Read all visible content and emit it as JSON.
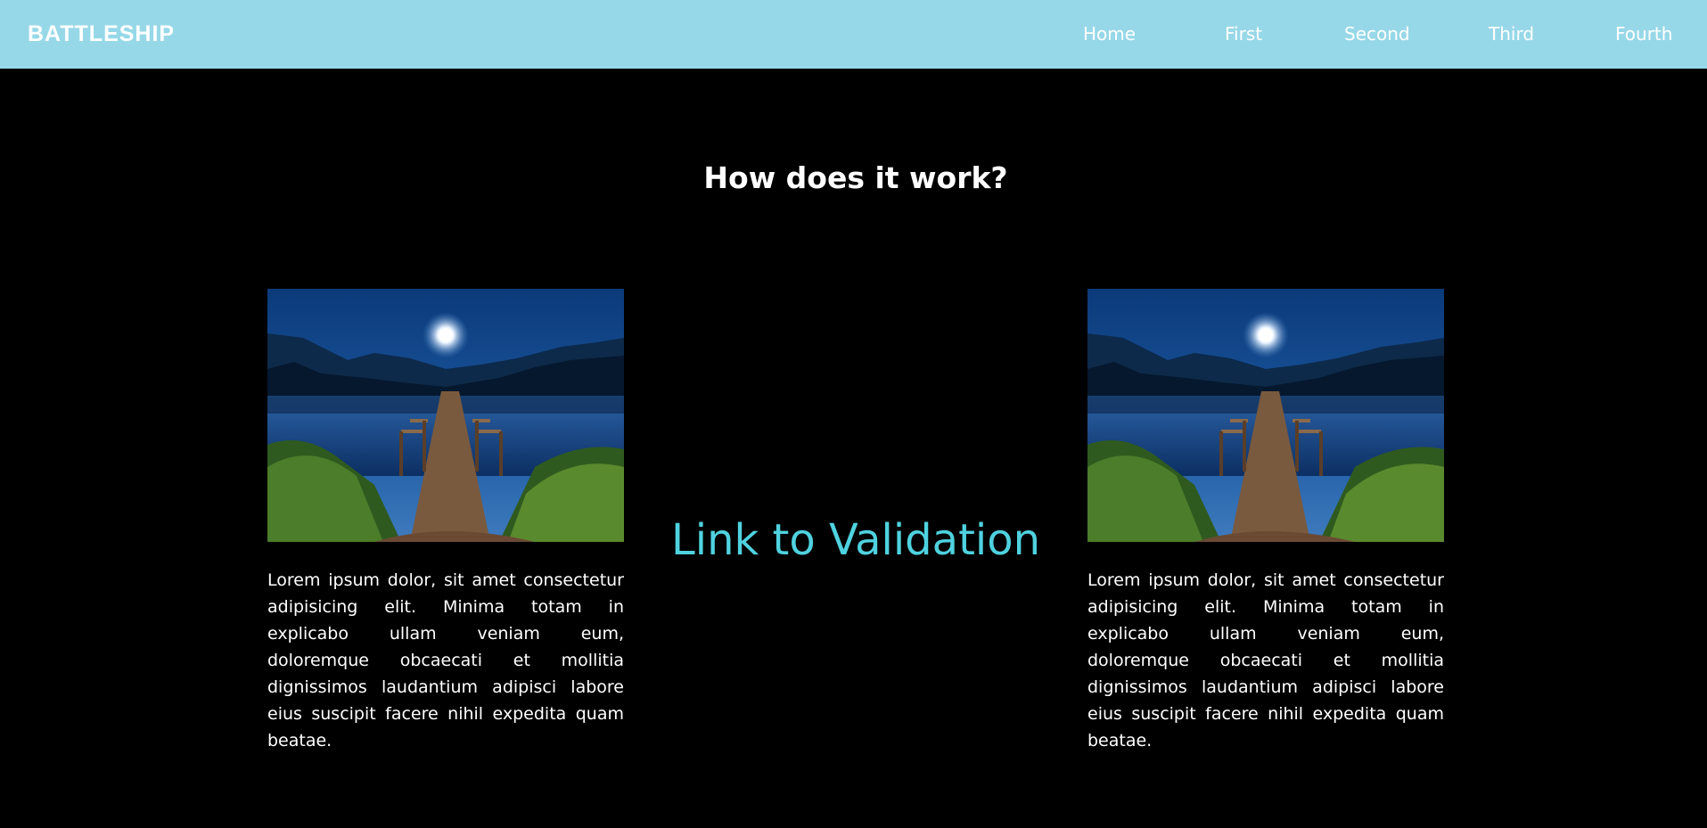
{
  "navbar": {
    "brand": "BATTLESHIP",
    "links": [
      "Home",
      "First",
      "Second",
      "Third",
      "Fourth"
    ]
  },
  "main": {
    "heading": "How does it work?",
    "center_link": "Link to Validation",
    "cards": [
      {
        "image": "night-lake-pier-photo",
        "text": "Lorem ipsum dolor, sit amet consectetur adipisicing elit. Minima totam in explicabo ullam veniam eum, doloremque obcaecati et mollitia dignissimos laudantium adipisci labore eius suscipit facere nihil expedita quam beatae."
      },
      {
        "image": "night-lake-pier-photo",
        "text": "Lorem ipsum dolor, sit amet consectetur adipisicing elit. Minima totam in explicabo ullam veniam eum, doloremque obcaecati et mollitia dignissimos laudantium adipisci labore eius suscipit facere nihil expedita quam beatae."
      }
    ]
  },
  "colors": {
    "navbar_bg": "#97d8e8",
    "page_bg": "#000000",
    "link": "#4fd2df",
    "text": "#ffffff"
  }
}
